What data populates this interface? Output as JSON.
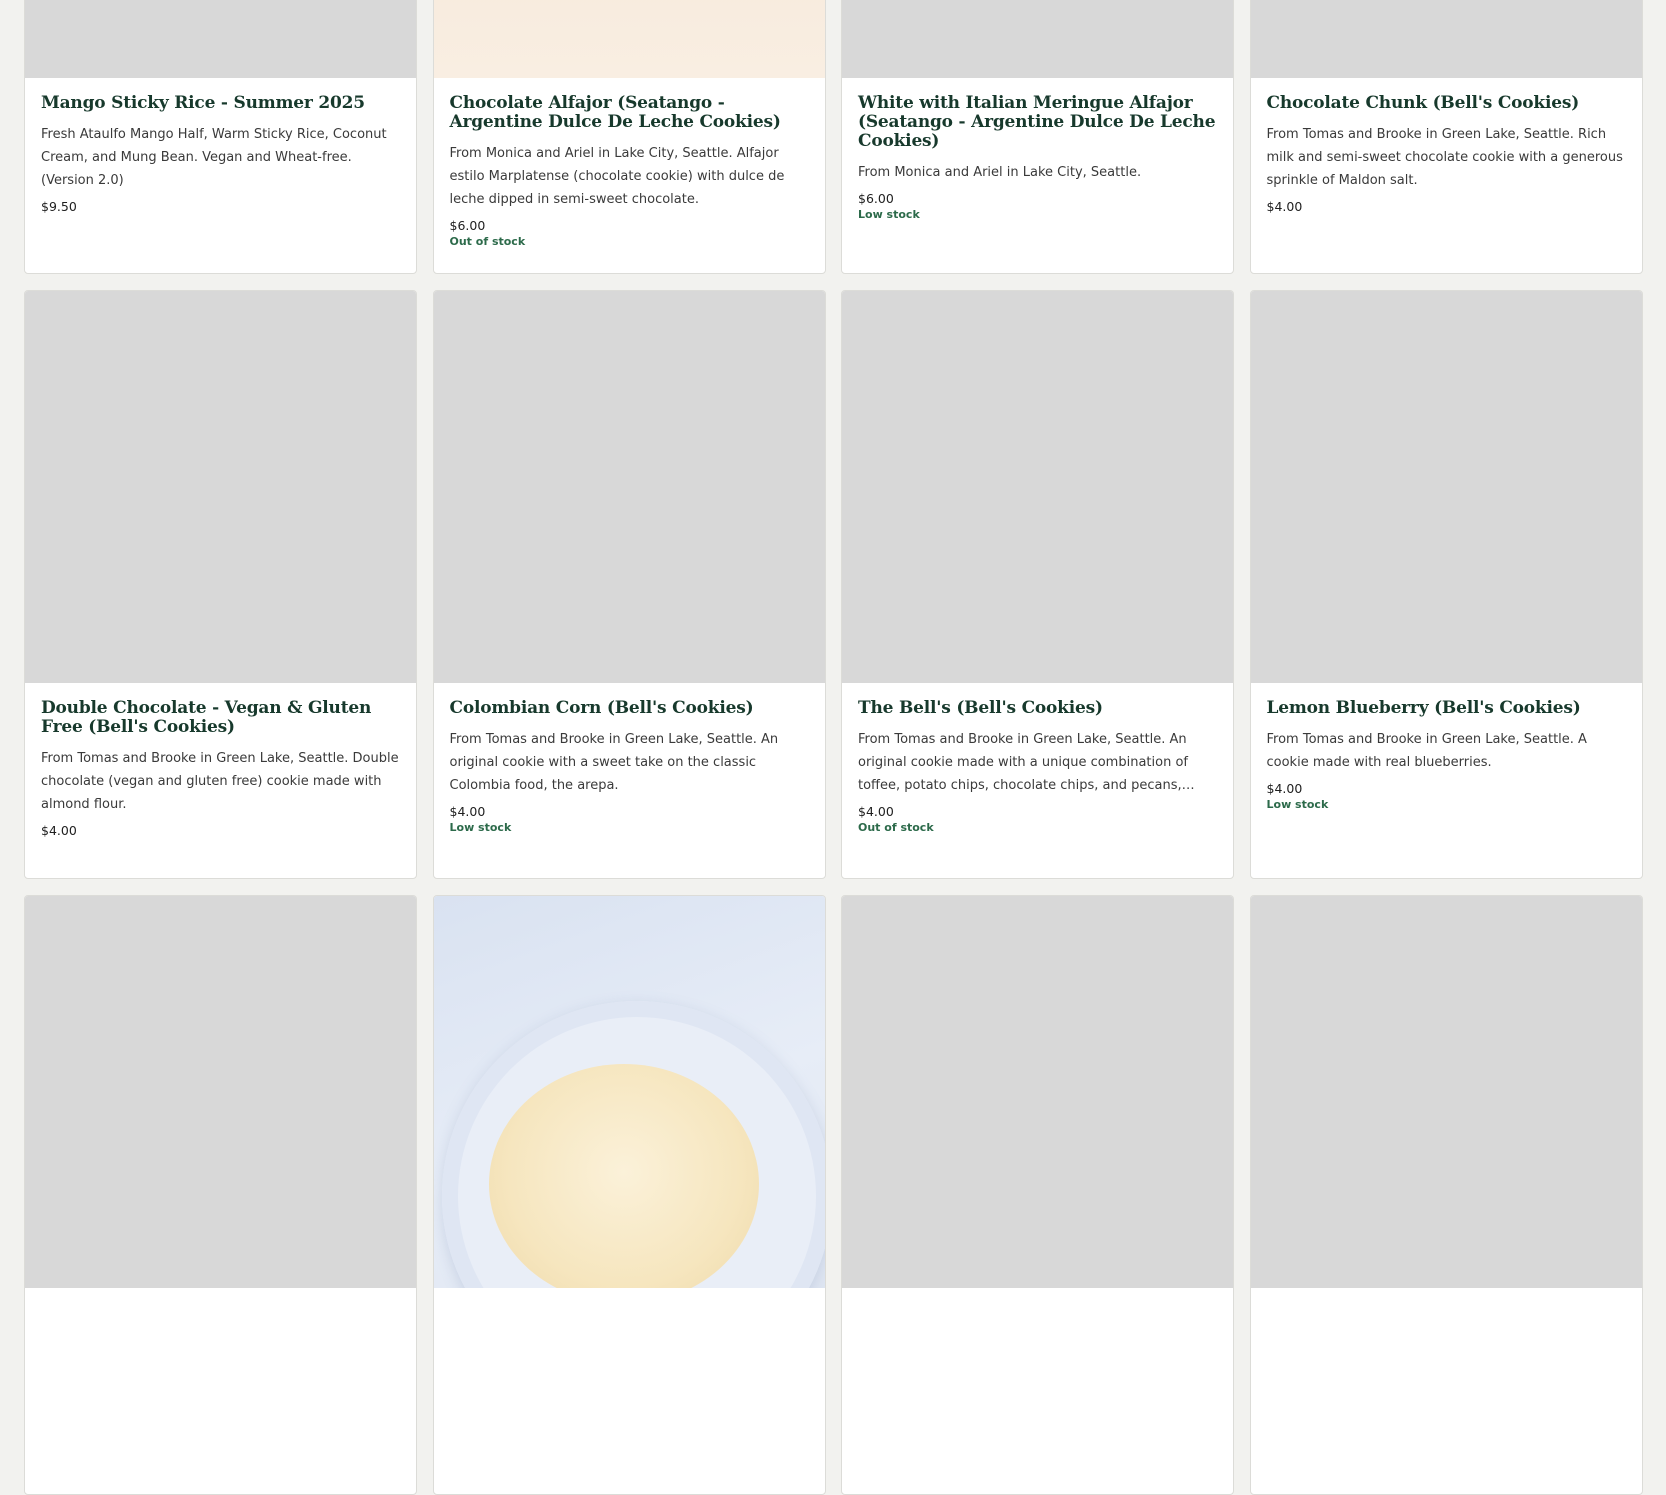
{
  "products": [
    {
      "title": "Mango Sticky Rice - Summer 2025",
      "description": "Fresh Ataulfo Mango Half, Warm Sticky Rice, Coconut Cream, and Mung Bean. Vegan and Wheat-free. (Version 2.0)",
      "price": "$9.50",
      "stock": ""
    },
    {
      "title": "Chocolate Alfajor (Seatango - Argentine Dulce De Leche Cookies)",
      "description": "From Monica and Ariel in Lake City, Seattle. Alfajor estilo Marplatense (chocolate cookie) with dulce de leche dipped in semi-sweet chocolate.",
      "price": "$6.00",
      "stock": "Out of stock"
    },
    {
      "title": "White with Italian Meringue Alfajor (Seatango - Argentine Dulce De Leche Cookies)",
      "description": "From Monica and Ariel in Lake City, Seattle.",
      "price": "$6.00",
      "stock": "Low stock"
    },
    {
      "title": "Chocolate Chunk (Bell's Cookies)",
      "description": "From Tomas and Brooke in Green Lake, Seattle. Rich milk and semi-sweet chocolate cookie with a generous sprinkle of Maldon salt.",
      "price": "$4.00",
      "stock": ""
    },
    {
      "title": "Double Chocolate - Vegan & Gluten Free (Bell's Cookies)",
      "description": "From Tomas and Brooke in Green Lake, Seattle. Double chocolate (vegan and gluten free) cookie made with almond flour.",
      "price": "$4.00",
      "stock": ""
    },
    {
      "title": "Colombian Corn (Bell's Cookies)",
      "description": "From Tomas and Brooke in Green Lake, Seattle. An original cookie with a sweet take on the classic Colombia food, the arepa.",
      "price": "$4.00",
      "stock": "Low stock"
    },
    {
      "title": "The Bell's (Bell's Cookies)",
      "description": "From Tomas and Brooke in Green Lake, Seattle. An original cookie made with a unique combination of toffee, potato chips, chocolate chips, and pecans, creates a delicious...",
      "price": "$4.00",
      "stock": "Out of stock"
    },
    {
      "title": "Lemon Blueberry (Bell's Cookies)",
      "description": "From Tomas and Brooke in Green Lake, Seattle. A cookie made with real blueberries.",
      "price": "$4.00",
      "stock": "Low stock"
    }
  ],
  "colors": {
    "page_bg": "#f2f2ef",
    "title": "#17392c",
    "stock": "#2c6a4a",
    "image_placeholder": "#d8d8d8"
  }
}
